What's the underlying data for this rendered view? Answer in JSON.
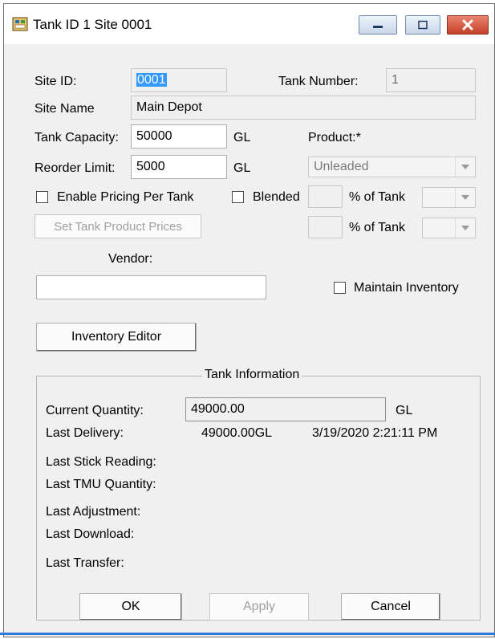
{
  "window": {
    "title": "Tank ID 1 Site 0001"
  },
  "form": {
    "site_id_label": "Site ID:",
    "site_id_value": "0001",
    "tank_number_label": "Tank Number:",
    "tank_number_value": "1",
    "site_name_label": "Site Name",
    "site_name_value": "Main Depot",
    "tank_capacity_label": "Tank Capacity:",
    "tank_capacity_value": "50000",
    "capacity_unit": "GL",
    "product_label": "Product:*",
    "reorder_limit_label": "Reorder Limit:",
    "reorder_limit_value": "5000",
    "reorder_unit": "GL",
    "product_value": "Unleaded",
    "enable_pricing_label": "Enable Pricing Per Tank",
    "blended_label": "Blended",
    "pct_of_tank_label_1": "% of Tank",
    "pct_of_tank_label_2": "% of Tank",
    "set_prices_button": "Set Tank Product Prices",
    "vendor_label": "Vendor:",
    "vendor_value": "",
    "maintain_inventory_label": "Maintain Inventory",
    "inventory_editor_button": "Inventory Editor"
  },
  "tank_info": {
    "title": "Tank Information",
    "current_quantity_label": "Current Quantity:",
    "current_quantity_value": "49000.00",
    "current_quantity_unit": "GL",
    "last_delivery_label": "Last Delivery:",
    "last_delivery_amount": "49000.00GL",
    "last_delivery_date": "3/19/2020 2:21:11 PM",
    "last_stick_reading_label": "Last Stick Reading:",
    "last_tmu_quantity_label": "Last TMU Quantity:",
    "last_adjustment_label": "Last Adjustment:",
    "last_download_label": "Last Download:",
    "last_transfer_label": "Last Transfer:"
  },
  "buttons": {
    "ok": "OK",
    "apply": "Apply",
    "cancel": "Cancel"
  },
  "colors": {
    "selection": "#3399ff",
    "close_button": "#c4412a",
    "dialog_bg": "#f0f0f0"
  }
}
